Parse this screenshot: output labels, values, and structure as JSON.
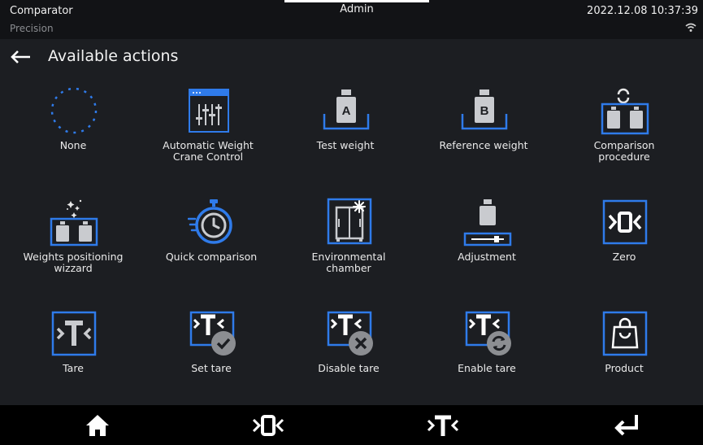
{
  "status": {
    "app_name": "Comparator",
    "profile": "Precision",
    "user": "Admin",
    "datetime": "2022.12.08 10:37:39",
    "wifi_icon": "wifi-icon"
  },
  "header": {
    "title": "Available actions",
    "back_icon": "back-arrow-icon"
  },
  "actions": [
    {
      "label": "None"
    },
    {
      "label": "Automatic Weight\nCrane Control"
    },
    {
      "label": "Test weight"
    },
    {
      "label": "Reference weight"
    },
    {
      "label": "Comparison\nprocedure"
    },
    {
      "label": "Weights positioning\nwizzard"
    },
    {
      "label": "Quick comparison"
    },
    {
      "label": "Environmental\nchamber"
    },
    {
      "label": "Adjustment"
    },
    {
      "label": "Zero"
    },
    {
      "label": "Tare"
    },
    {
      "label": "Set tare"
    },
    {
      "label": "Disable tare"
    },
    {
      "label": "Enable tare"
    },
    {
      "label": "Product"
    }
  ],
  "nav": {
    "home_icon": "home-icon",
    "zero_icon": "zero-icon",
    "tare_icon": "tare-icon",
    "enter_icon": "enter-icon"
  },
  "colors": {
    "accent": "#2f7bea",
    "icon_gray": "#c9cbcf",
    "background": "#1c1e22"
  }
}
